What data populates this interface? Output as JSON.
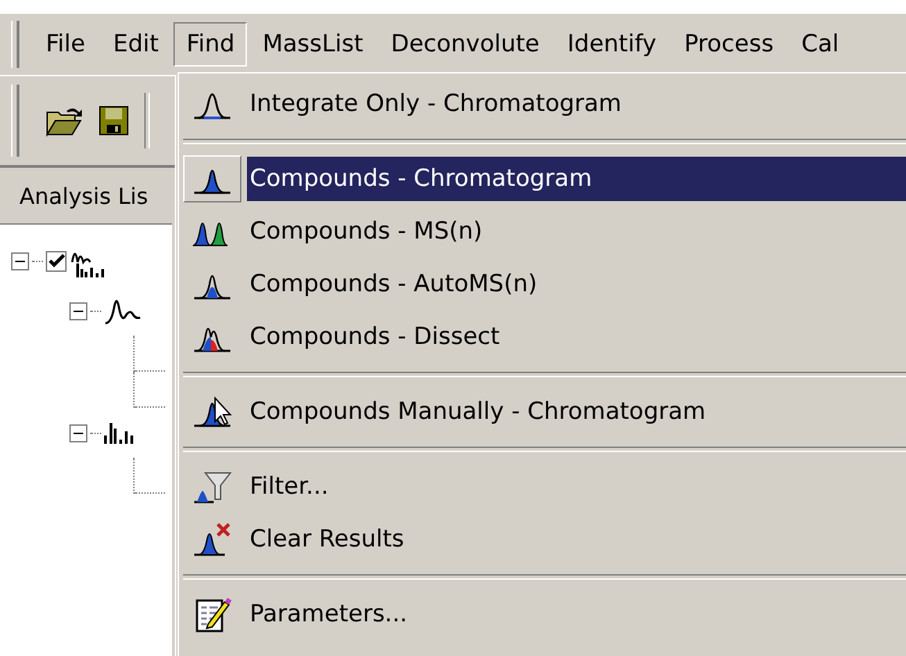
{
  "menubar": {
    "items": [
      {
        "label": "File",
        "selected": false
      },
      {
        "label": "Edit",
        "selected": false
      },
      {
        "label": "Find",
        "selected": true
      },
      {
        "label": "MassList",
        "selected": false
      },
      {
        "label": "Deconvolute",
        "selected": false
      },
      {
        "label": "Identify",
        "selected": false
      },
      {
        "label": "Process",
        "selected": false
      },
      {
        "label": "Cal",
        "selected": false
      }
    ]
  },
  "toolbar": {
    "buttons": [
      {
        "kind": "open"
      },
      {
        "kind": "save"
      }
    ]
  },
  "panel": {
    "tab": "Analysis Lis",
    "tree": [
      {
        "kind": "analysis",
        "checked": true,
        "expanded": true,
        "children": [
          {
            "kind": "chromatogram",
            "expanded": true,
            "children": [
              {
                "kind": "leaf"
              },
              {
                "kind": "leaf"
              }
            ]
          },
          {
            "kind": "spectrum",
            "expanded": true,
            "children": [
              {
                "kind": "leaf"
              }
            ]
          }
        ]
      }
    ]
  },
  "menu": {
    "items": [
      {
        "kind": "integrate",
        "label": "Integrate Only - Chromatogram",
        "selected": false
      },
      {
        "kind": "separator"
      },
      {
        "kind": "chromatogram",
        "label": "Compounds - Chromatogram",
        "selected": true
      },
      {
        "kind": "msn",
        "label": "Compounds - MS(n)",
        "selected": false
      },
      {
        "kind": "automs",
        "label": "Compounds - AutoMS(n)",
        "selected": false
      },
      {
        "kind": "dissect",
        "label": "Compounds - Dissect",
        "selected": false
      },
      {
        "kind": "separator"
      },
      {
        "kind": "manual",
        "label": "Compounds Manually - Chromatogram",
        "selected": false
      },
      {
        "kind": "separator"
      },
      {
        "kind": "filter",
        "label": "Filter...",
        "selected": false
      },
      {
        "kind": "clear",
        "label": "Clear Results",
        "selected": false
      },
      {
        "kind": "separator"
      },
      {
        "kind": "parameters",
        "label": "Parameters...",
        "selected": false
      }
    ]
  }
}
